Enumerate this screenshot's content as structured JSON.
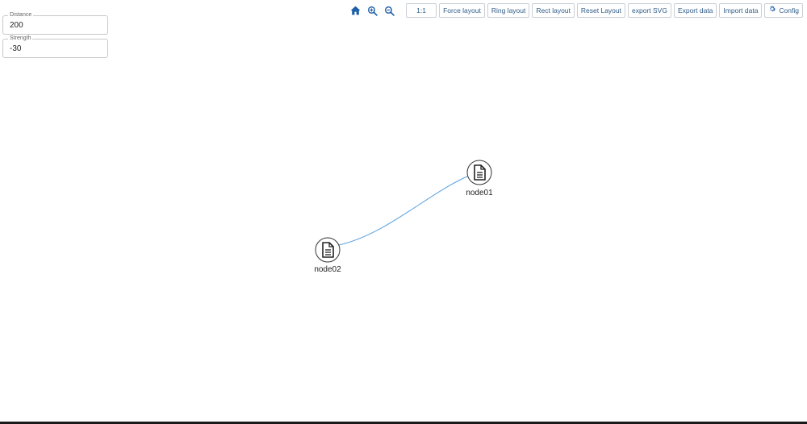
{
  "controls": {
    "distance": {
      "label": "Distance",
      "value": "200"
    },
    "strength": {
      "label": "Strength",
      "value": "-30"
    }
  },
  "toolbar": {
    "home_icon": "home-icon",
    "zoom_in_icon": "zoom-in-icon",
    "zoom_out_icon": "zoom-out-icon",
    "scale_label": "1:1",
    "force_layout": "Force layout",
    "ring_layout": "Ring layout",
    "rect_layout": "Rect layout",
    "reset_layout": "Reset Layout",
    "export_svg": "export SVG",
    "export_data": "Export data",
    "import_data": "Import data",
    "config": "Config",
    "config_icon": "gear-icon",
    "accent_color": "#1f5fa8"
  },
  "graph": {
    "nodes": [
      {
        "id": "node01",
        "label": "node01",
        "icon": "document-icon"
      },
      {
        "id": "node02",
        "label": "node02",
        "icon": "document-icon"
      }
    ],
    "links": [
      {
        "source": "node02",
        "target": "node01",
        "color": "#5aa0e0"
      }
    ]
  }
}
